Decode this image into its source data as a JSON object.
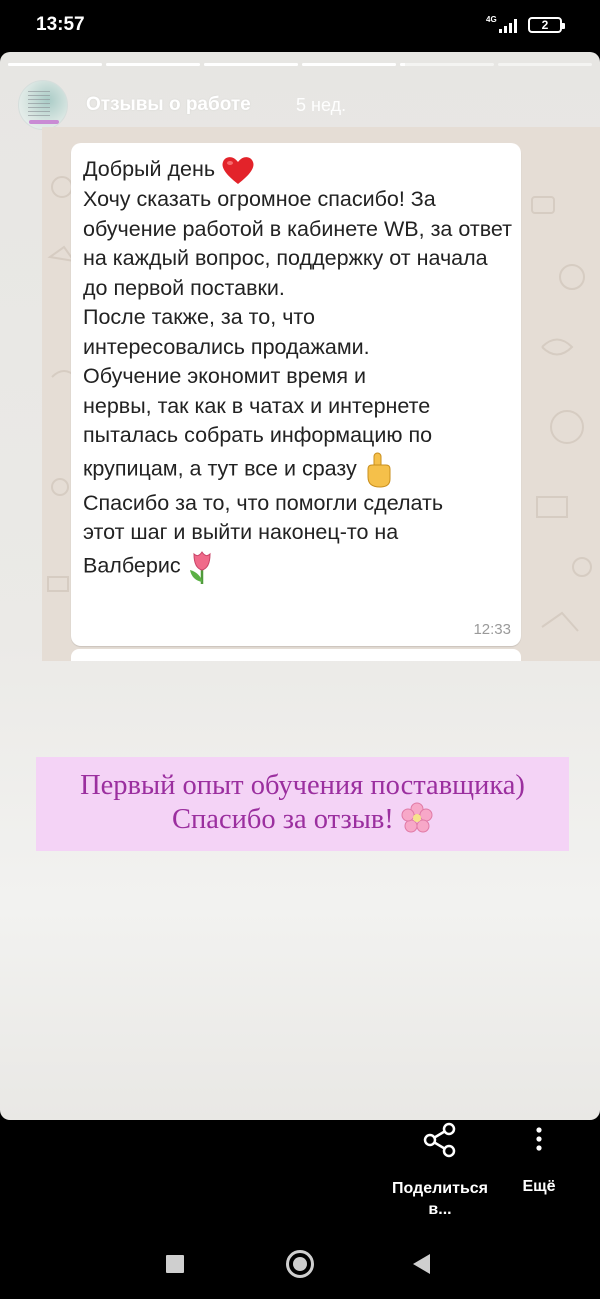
{
  "status_bar": {
    "time": "13:57",
    "network_type": "4G",
    "battery_level": "2"
  },
  "story": {
    "progress": {
      "segments_total": 6,
      "current_segment": 5,
      "current_fraction": 0.05
    },
    "header": {
      "account_name": "Отзывы о работе",
      "post_age": "5 нед."
    },
    "chat_message": {
      "greeting": "Добрый день",
      "paragraph1": "Хочу сказать огромное спасибо! За обучение работой в кабинете WB, за ответ на каждый вопрос, поддержку от начала до первой поставки.",
      "paragraph2_lines": [
        "После также, за то, что",
        "интересовались продажами.",
        "Обучение экономит время и",
        "нервы, так как в чатах и интернете",
        "пыталась собрать информацию по",
        "крупицам, а тут все и сразу"
      ],
      "paragraph3_lines": [
        "Спасибо за то, что помогли сделать",
        "этот шаг и выйти наконец-то на",
        "Валберис"
      ],
      "time": "12:33",
      "emojis": [
        "heart-icon",
        "pointing-up-icon",
        "tulip-icon"
      ]
    },
    "caption": {
      "line1": "Первый опыт обучения поставщика)",
      "line2": "Спасибо за отзыв!",
      "emoji": "cherry-blossom-icon",
      "text_color": "#9b2f9f",
      "background_color": "#f4d3f6"
    }
  },
  "actions": {
    "share_label": "Поделиться в...",
    "more_label": "Ещё"
  },
  "nav_bar": {
    "buttons": [
      "recents-button",
      "home-button",
      "back-button"
    ]
  }
}
